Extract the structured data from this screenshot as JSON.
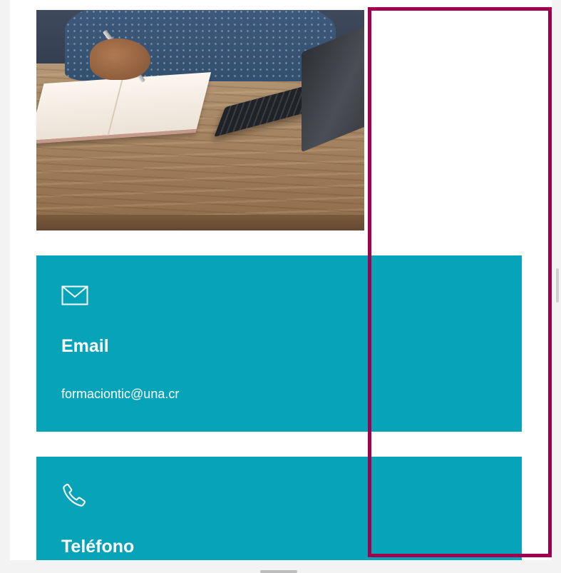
{
  "contact": {
    "email": {
      "icon": "envelope-icon",
      "title": "Email",
      "value": "formaciontic@una.cr"
    },
    "phone": {
      "icon": "phone-icon",
      "title": "Teléfono"
    }
  },
  "colors": {
    "card_background": "#06a3b9",
    "card_text": "#ffffff",
    "highlight_border": "#a0004f",
    "page_background": "#ffffff"
  }
}
